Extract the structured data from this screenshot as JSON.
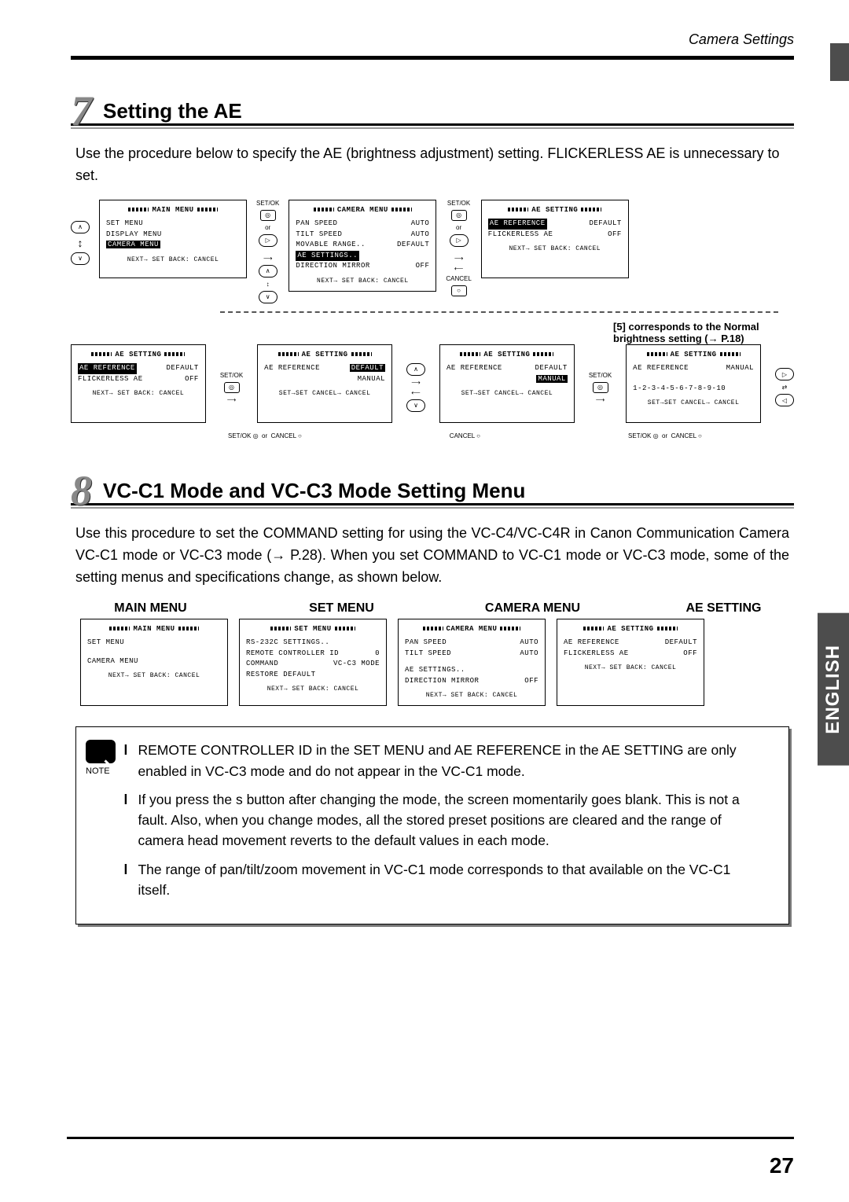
{
  "header": {
    "right": "Camera Settings"
  },
  "section7": {
    "num": "7",
    "title": "Setting the AE",
    "paragraph": "Use the procedure below to specify the AE (brightness adjustment) setting. FLICKERLESS AE is unnecessary to set."
  },
  "flow": {
    "main_menu": {
      "title": "MAIN  MENU",
      "items": [
        "SET MENU",
        "DISPLAY MENU",
        "CAMERA MENU"
      ],
      "highlight": "CAMERA MENU",
      "foot": "NEXT→ SET  BACK: CANCEL"
    },
    "camera_menu": {
      "title": "CAMERA MENU",
      "rows": [
        [
          "PAN  SPEED",
          "AUTO"
        ],
        [
          "TILT SPEED",
          "AUTO"
        ],
        [
          "MOVABLE RANGE..",
          "DEFAULT"
        ],
        [
          "AE SETTINGS..",
          ""
        ],
        [
          "DIRECTION MIRROR",
          "OFF"
        ]
      ],
      "highlight_row": 3,
      "foot": "NEXT→ SET  BACK: CANCEL"
    },
    "ae1": {
      "title": "AE SETTING",
      "rows": [
        [
          "AE REFERENCE",
          "DEFAULT"
        ],
        [
          "FLICKERLESS AE",
          "OFF"
        ]
      ],
      "highlight_row": 0,
      "foot": "NEXT→ SET   BACK: CANCEL"
    },
    "note": "[5] corresponds to the Normal brightness setting (→ P.18)",
    "ae_row2a": {
      "title": "AE SETTING",
      "rows": [
        [
          "AE REFERENCE",
          "DEFAULT"
        ],
        [
          "FLICKERLESS AE",
          "OFF"
        ]
      ],
      "highlight_row": 0,
      "foot": "NEXT→ SET   BACK: CANCEL"
    },
    "ae_row2b": {
      "title": "AE SETTING",
      "rows": [
        [
          "AE REFERENCE",
          "DEFAULT MANUAL"
        ]
      ],
      "foot": "SET→SET CANCEL→ CANCEL",
      "hl_val": "DEFAULT"
    },
    "ae_row2c": {
      "title": "AE SETTING",
      "rows": [
        [
          "AE REFERENCE",
          "DEFAULT MANUAL"
        ]
      ],
      "foot": "SET→SET CANCEL→ CANCEL",
      "hl_val": "MANUAL"
    },
    "ae_row2d": {
      "title": "AE SETTING",
      "rows": [
        [
          "AE REFERENCE",
          "MANUAL"
        ]
      ],
      "scale": "1-2-3-4-5-6-7-8-9-10",
      "foot": "SET→SET CANCEL→ CANCEL"
    },
    "btn_labels": {
      "setok": "SET/OK",
      "cancel": "CANCEL",
      "or": "or"
    }
  },
  "section8": {
    "num": "8",
    "title": "VC-C1 Mode and VC-C3 Mode Setting Menu",
    "paragraph": "Use this procedure to set the COMMAND setting for using the VC-C4/VC-C4R in Canon Communication Camera VC-C1 mode or VC-C3 mode (→ P.28). When you set COMMAND to VC-C1 mode or VC-C3 mode, some of the setting menus and specifications change, as shown below."
  },
  "menus": {
    "labels": [
      "MAIN MENU",
      "SET MENU",
      "CAMERA MENU",
      "AE SETTING"
    ],
    "main": {
      "title": "MAIN  MENU",
      "items": [
        "SET MENU",
        "",
        "CAMERA MENU"
      ],
      "foot": "NEXT→ SET  BACK: CANCEL"
    },
    "set": {
      "title": "SET MENU",
      "rows": [
        [
          "RS-232C SETTINGS..",
          ""
        ],
        [
          "REMOTE CONTROLLER ID",
          "0"
        ],
        [
          "COMMAND",
          "VC-C3 MODE"
        ],
        [
          "RESTORE DEFAULT",
          ""
        ]
      ],
      "foot": "NEXT→ SET   BACK: CANCEL"
    },
    "cam": {
      "title": "CAMERA MENU",
      "rows": [
        [
          "PAN  SPEED",
          "AUTO"
        ],
        [
          "TILT SPEED",
          "AUTO"
        ],
        [
          "",
          ""
        ],
        [
          "AE SETTINGS..",
          ""
        ],
        [
          "DIRECTION MIRROR",
          "OFF"
        ]
      ],
      "foot": "NEXT→ SET  BACK: CANCEL"
    },
    "ae": {
      "title": "AE SETTING",
      "rows": [
        [
          "AE REFERENCE",
          "DEFAULT"
        ],
        [
          "FLICKERLESS AE",
          "OFF"
        ]
      ],
      "foot": "NEXT→ SET   BACK: CANCEL"
    }
  },
  "note_box": {
    "label": "NOTE",
    "items": [
      "REMOTE CONTROLLER ID in the SET MENU and AE REFERENCE in the AE SETTING are only enabled in VC-C3 mode and do not appear in the VC-C1 mode.",
      "If you press the s    button after changing the mode, the screen momentarily goes blank. This is not a fault. Also, when you change modes, all the stored preset positions are cleared and the range of camera head movement reverts to the default values in each mode.",
      "The range of pan/tilt/zoom movement in VC-C1 mode corresponds to that available on the VC-C1 itself."
    ]
  },
  "side_lang": "ENGLISH",
  "page_num": "27"
}
